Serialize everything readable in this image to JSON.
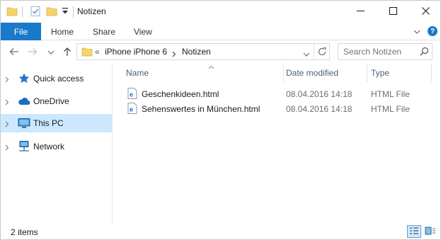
{
  "window": {
    "title": "Notizen",
    "controls": [
      "minimize",
      "maximize",
      "close"
    ]
  },
  "ribbon": {
    "file_tab": "File",
    "tabs": [
      "Home",
      "Share",
      "View"
    ],
    "help": "?"
  },
  "address": {
    "overflow": "«",
    "crumbs": [
      "iPhone iPhone 6",
      "Notizen"
    ],
    "search_placeholder": "Search Notizen"
  },
  "nav_pane": {
    "items": [
      {
        "label": "Quick access",
        "icon": "star-icon"
      },
      {
        "label": "OneDrive",
        "icon": "cloud-icon"
      },
      {
        "label": "This PC",
        "icon": "monitor-icon",
        "selected": true
      },
      {
        "label": "Network",
        "icon": "network-icon"
      }
    ]
  },
  "content": {
    "columns": {
      "name": "Name",
      "date": "Date modified",
      "type": "Type"
    },
    "sorted_by": "Name",
    "files": [
      {
        "name": "Geschenkideen.html",
        "date": "08.04.2016 14:18",
        "type": "HTML File",
        "icon": "ie-document-icon"
      },
      {
        "name": "Sehenswertes in München.html",
        "date": "08.04.2016 14:18",
        "type": "HTML File",
        "icon": "ie-document-icon"
      }
    ]
  },
  "status": {
    "item_count": "2 items",
    "view_modes": [
      "details",
      "large-icons"
    ],
    "active_view": "details"
  },
  "colors": {
    "accent": "#1979ca",
    "selection": "#cce8ff",
    "folder": "#f5d56a"
  }
}
